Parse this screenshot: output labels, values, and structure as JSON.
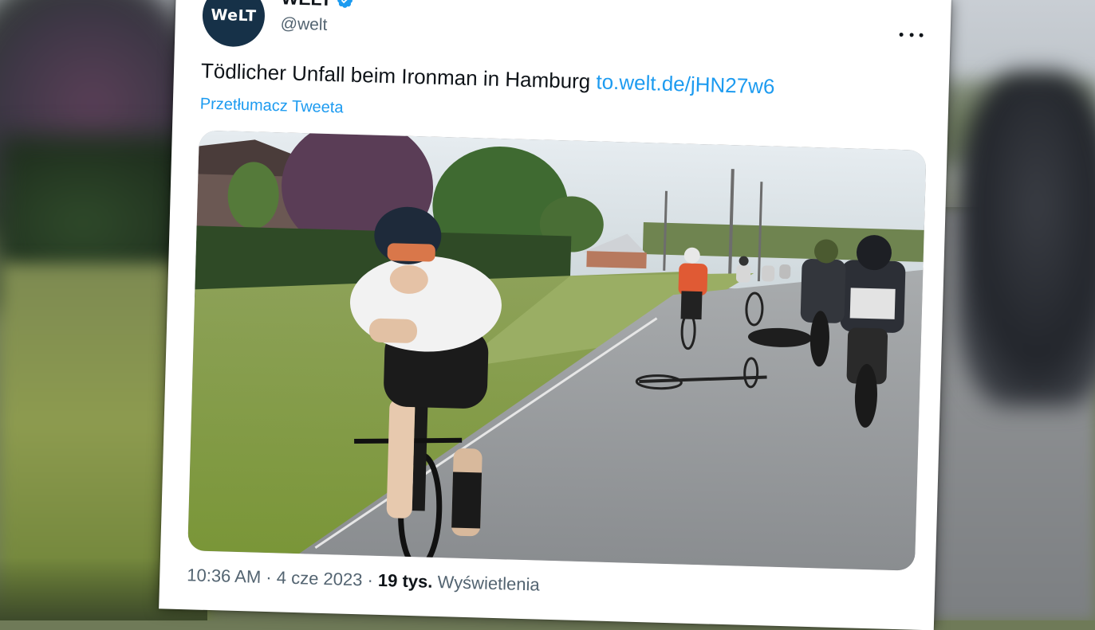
{
  "account": {
    "avatar_text": "WeLT",
    "name": "WELT",
    "handle": "@welt",
    "verified": true
  },
  "tweet": {
    "text": "Tödlicher Unfall beim Ironman in Hamburg",
    "link": "to.welt.de/jHN27w6",
    "translate_label": "Przetłumacz Tweeta"
  },
  "meta": {
    "time": "10:36 AM",
    "separator": "·",
    "date": "4 cze 2023",
    "views_count": "19 tys.",
    "views_label": "Wyświetlenia"
  },
  "icons": {
    "more": "more-horizontal-icon",
    "verified": "verified-badge-icon"
  },
  "colors": {
    "link": "#1d9bf0",
    "avatar_bg": "#163148",
    "verified": "#1d9bf0"
  }
}
